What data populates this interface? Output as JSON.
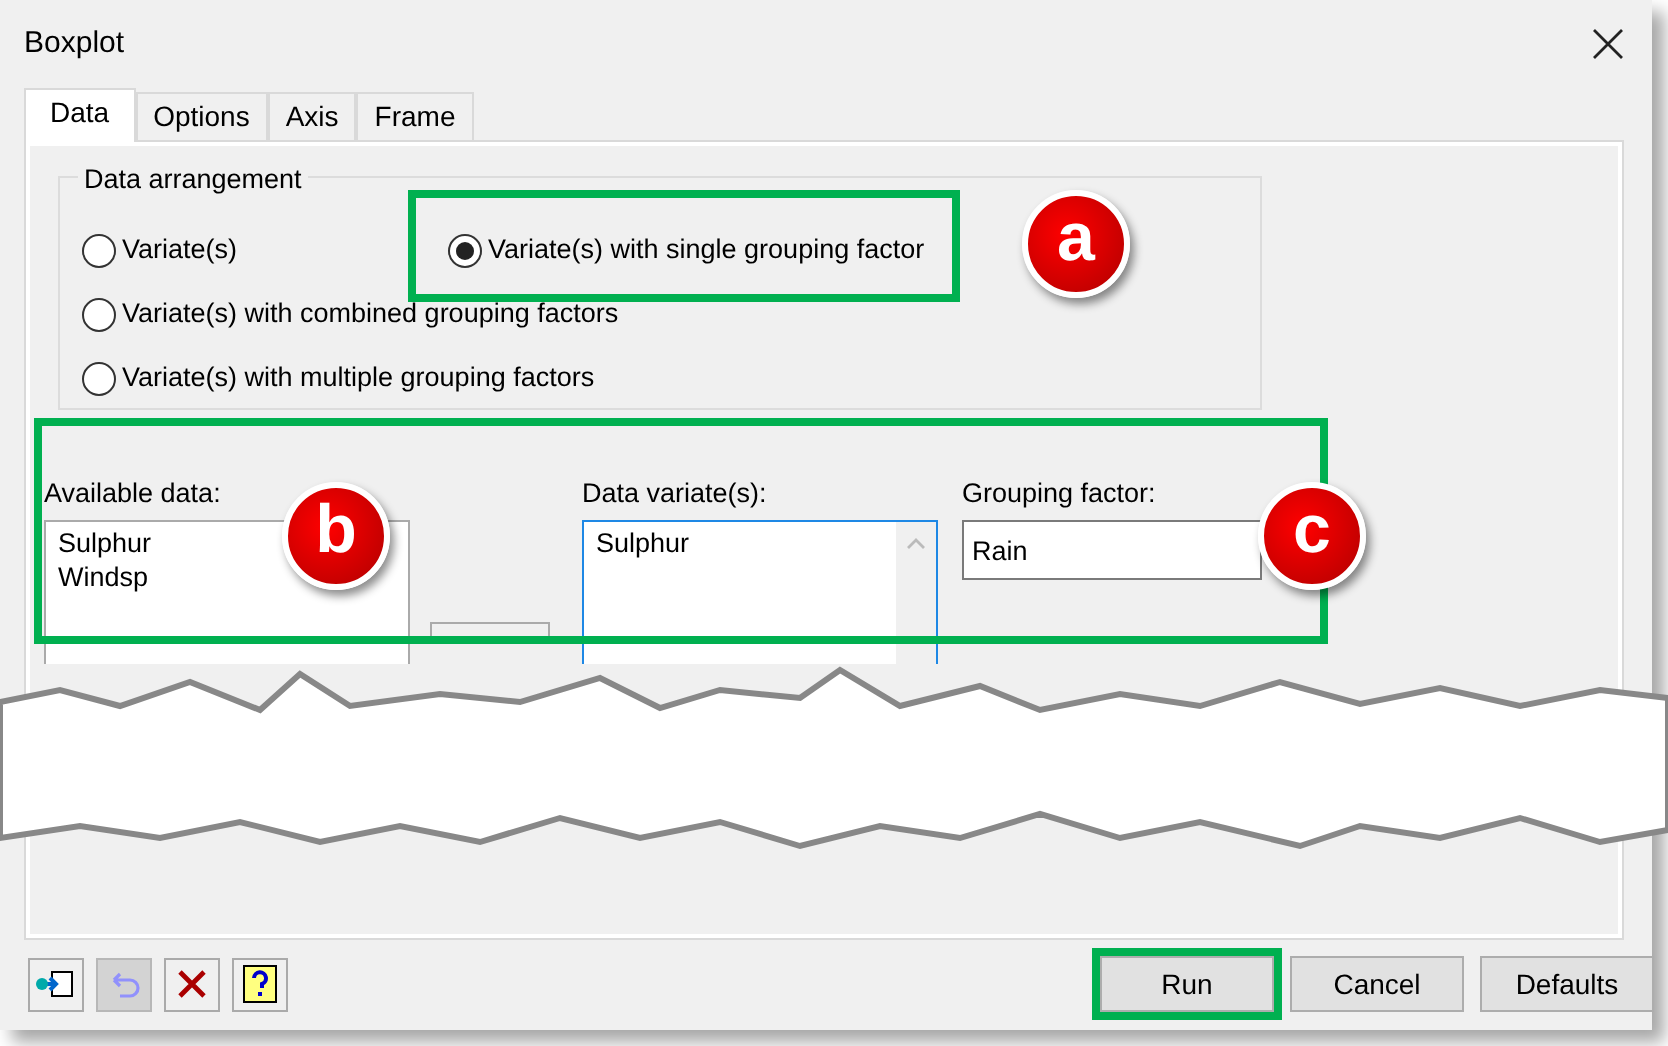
{
  "window": {
    "title": "Boxplot"
  },
  "tabs": [
    {
      "label": "Data",
      "selected": true
    },
    {
      "label": "Options",
      "selected": false
    },
    {
      "label": "Axis",
      "selected": false
    },
    {
      "label": "Frame",
      "selected": false
    }
  ],
  "arrangement": {
    "title": "Data arrangement",
    "options": [
      {
        "label": "Variate(s)",
        "selected": false,
        "highlighted": false
      },
      {
        "label": "Variate(s) with single grouping factor",
        "selected": true,
        "highlighted": true
      },
      {
        "label": "Variate(s) with combined grouping factors",
        "selected": false,
        "highlighted": false
      },
      {
        "label": "Variate(s) with multiple grouping factors",
        "selected": false,
        "highlighted": false
      }
    ]
  },
  "data_selection": {
    "highlighted": true,
    "available": {
      "label": "Available data:",
      "items": [
        "Sulphur",
        "Windsp"
      ]
    },
    "variates": {
      "label": "Data variate(s):",
      "items": [
        "Sulphur"
      ]
    },
    "grouping": {
      "label": "Grouping factor:",
      "value": "Rain"
    }
  },
  "callouts": [
    {
      "label": "a"
    },
    {
      "label": "b"
    },
    {
      "label": "c"
    }
  ],
  "toolbar": [
    {
      "kind": "import",
      "disabled": false
    },
    {
      "kind": "undo",
      "disabled": true
    },
    {
      "kind": "clear",
      "disabled": false
    },
    {
      "kind": "help",
      "disabled": false
    }
  ],
  "buttons": [
    {
      "label": "Run",
      "highlighted": true
    },
    {
      "label": "Cancel",
      "highlighted": false
    },
    {
      "label": "Defaults",
      "highlighted": false
    }
  ]
}
